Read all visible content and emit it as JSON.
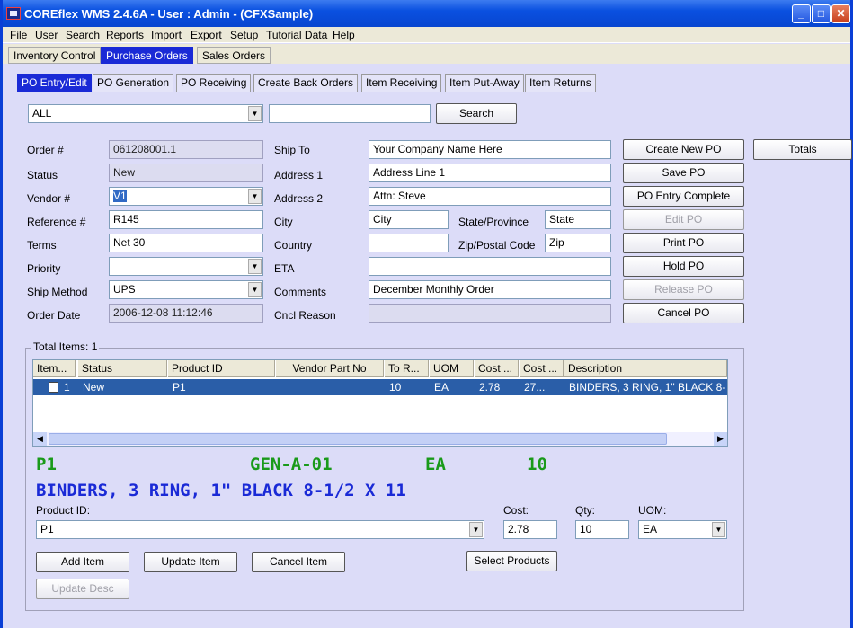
{
  "window": {
    "title": "COREflex WMS 2.4.6A - User : Admin - (CFXSample)",
    "minimize_glyph": "_",
    "maximize_glyph": "□",
    "close_glyph": "✕"
  },
  "menu": [
    "File",
    "User",
    "Search",
    "Reports",
    "Import",
    "Export",
    "Setup",
    "Tutorial Data",
    "Help"
  ],
  "module_tabs": [
    "Inventory Control",
    "Purchase Orders",
    "Sales Orders"
  ],
  "sub_tabs": [
    "PO Entry/Edit",
    "PO Generation",
    "PO Receiving",
    "Create Back Orders",
    "Item Receiving",
    "Item Put-Away",
    "Item Returns"
  ],
  "search": {
    "filter": "ALL",
    "text": "",
    "button": "Search"
  },
  "order": {
    "order_no_label": "Order #",
    "order_no": "061208001.1",
    "status_label": "Status",
    "status": "New",
    "vendor_label": "Vendor #",
    "vendor": "V1",
    "reference_label": "Reference #",
    "reference": "R145",
    "terms_label": "Terms",
    "terms": "Net 30",
    "priority_label": "Priority",
    "priority": "",
    "ship_method_label": "Ship Method",
    "ship_method": "UPS",
    "order_date_label": "Order Date",
    "order_date": "2006-12-08 11:12:46"
  },
  "ship": {
    "ship_to_label": "Ship To",
    "ship_to": "Your Company Name Here",
    "address1_label": "Address 1",
    "address1": "Address Line 1",
    "address2_label": "Address 2",
    "address2": "Attn: Steve",
    "city_label": "City",
    "city": "City",
    "state_label": "State/Province",
    "state": "State",
    "country_label": "Country",
    "country": "",
    "zip_label": "Zip/Postal Code",
    "zip": "Zip",
    "eta_label": "ETA",
    "eta": "",
    "comments_label": "Comments",
    "comments": "December Monthly Order",
    "cancel_reason_label": "Cncl Reason",
    "cancel_reason": ""
  },
  "actions": {
    "create_new_po": "Create New PO",
    "save_po": "Save PO",
    "po_entry_complete": "PO Entry Complete",
    "edit_po": "Edit PO",
    "print_po": "Print PO",
    "hold_po": "Hold PO",
    "release_po": "Release PO",
    "cancel_po": "Cancel PO",
    "totals": "Totals"
  },
  "items": {
    "caption": "Total Items: 1",
    "columns": [
      "Item...",
      "Status",
      "Product ID",
      "Vendor Part No",
      "To R...",
      "UOM",
      "Cost ...",
      "Cost ...",
      "Description"
    ],
    "row": {
      "item": "1",
      "status": "New",
      "product_id": "P1",
      "vendor_part_no": "",
      "to_receive": "10",
      "uom": "EA",
      "cost": "2.78",
      "cost_total": "27...",
      "description": "BINDERS, 3 RING, 1\" BLACK 8-1/2 X 11"
    }
  },
  "detail": {
    "product": "P1",
    "location": "GEN-A-01",
    "uom": "EA",
    "qty": "10",
    "description": "BINDERS, 3 RING, 1\" BLACK 8-1/2 X 11"
  },
  "entry": {
    "product_label": "Product ID:",
    "product": "P1",
    "cost_label": "Cost:",
    "cost": "2.78",
    "qty_label": "Qty:",
    "qty": "10",
    "uom_label": "UOM:",
    "uom": "EA"
  },
  "item_buttons": {
    "add": "Add Item",
    "update": "Update Item",
    "cancel": "Cancel Item",
    "select_products": "Select Products",
    "update_desc": "Update Desc"
  }
}
